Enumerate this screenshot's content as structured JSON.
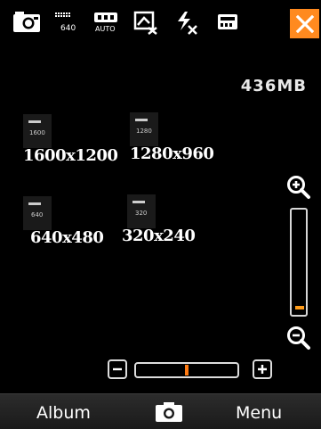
{
  "toolbar": {
    "icons": [
      "camera-mode-icon",
      "resolution-640-icon",
      "white-balance-auto-icon",
      "effects-off-icon",
      "flash-off-icon",
      "storage-card-icon"
    ],
    "resolution_badge": "640",
    "wb_badge": "AUTO"
  },
  "storage": {
    "free": "436MB"
  },
  "resolutions": [
    {
      "badge": "1600",
      "label": "1600x1200"
    },
    {
      "badge": "1280",
      "label": "1280x960"
    },
    {
      "badge": "640",
      "label": "640x480"
    },
    {
      "badge": "320",
      "label": "320x240"
    }
  ],
  "zoom": {
    "level_fraction": 0.0
  },
  "exposure": {
    "value_fraction": 0.5
  },
  "bottom_bar": {
    "left_label": "Album",
    "right_label": "Menu"
  },
  "colors": {
    "accent": "#ff8a1f",
    "background": "#000000"
  }
}
